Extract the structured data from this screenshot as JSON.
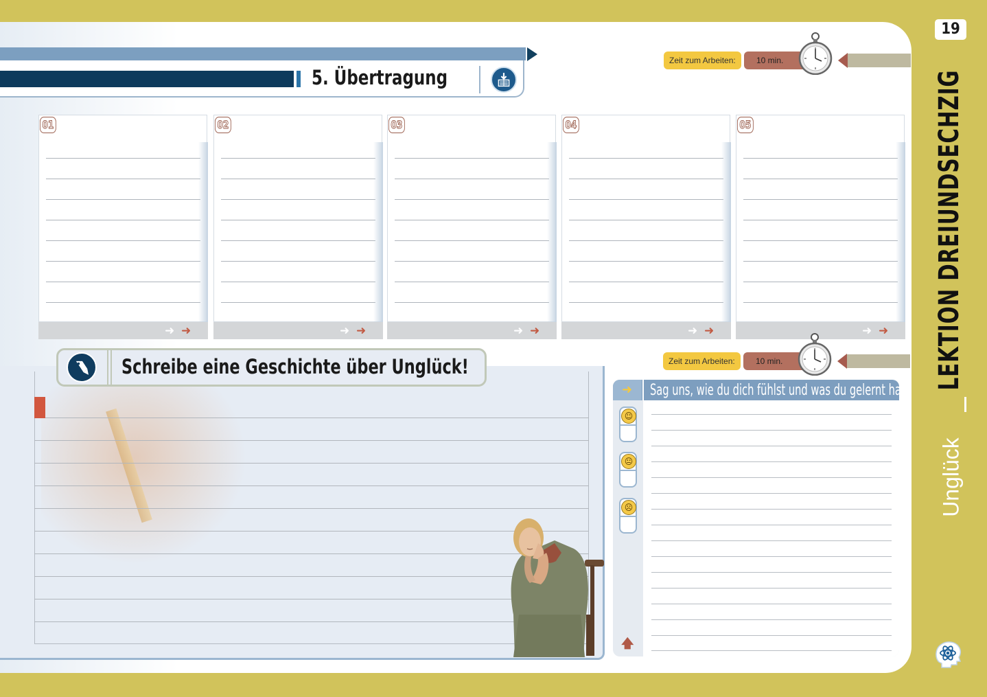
{
  "page_number": "19",
  "sidebar": {
    "lesson_title": "LEKTION DREIUNDSECHZIG",
    "topic": "Unglück",
    "icon": "brain-atom-icon"
  },
  "section": {
    "title": "5. Übertragung",
    "icon": "download-list-icon"
  },
  "timer_top": {
    "label": "Zeit zum Arbeiten:",
    "value": "10 min.",
    "icon": "stopwatch-icon"
  },
  "timer_bottom": {
    "label": "Zeit zum Arbeiten:",
    "value": "10 min.",
    "icon": "stopwatch-icon"
  },
  "cards": [
    {
      "number": "01"
    },
    {
      "number": "02"
    },
    {
      "number": "03"
    },
    {
      "number": "04"
    },
    {
      "number": "05"
    }
  ],
  "task": {
    "title": "Schreibe eine Geschichte über Unglück!",
    "icon": "pen-writing-icon"
  },
  "feedback": {
    "title": "Sag uns, wie du dich fühlst und was du gelernt hast !",
    "moods": [
      "happy-face-icon",
      "neutral-face-icon",
      "sad-face-icon"
    ]
  },
  "colors": {
    "background": "#d1c35b",
    "navy": "#0d3a5c",
    "steel_blue": "#7c9fc0",
    "accent_red": "#c25a43",
    "timer_yellow": "#f3c841",
    "timer_brown": "#b3705f"
  }
}
